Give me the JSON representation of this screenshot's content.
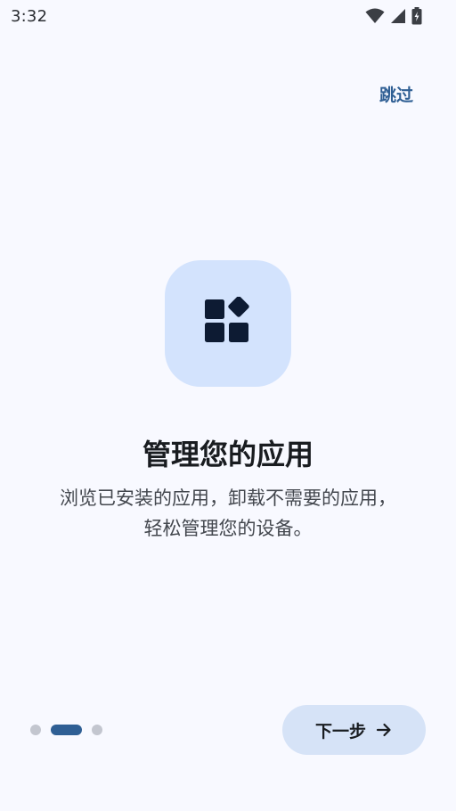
{
  "status_bar": {
    "time": "3:32",
    "icons": [
      "wifi-icon",
      "cellular-signal-icon",
      "battery-charging-icon"
    ]
  },
  "onboarding": {
    "skip_label": "跳过",
    "hero_icon": "widgets-icon",
    "title": "管理您的应用",
    "description": "浏览已安装的应用，卸载不需要的应用，轻松管理您的设备。",
    "page_index": 2,
    "page_count": 3,
    "next_label": "下一步",
    "next_icon": "arrow-right-icon"
  },
  "colors": {
    "background": "#f8f9ff",
    "accent": "#2f5f94",
    "tile": "#d3e3fd",
    "button": "#d6e3f7",
    "icon_dark": "#0d1b33"
  }
}
